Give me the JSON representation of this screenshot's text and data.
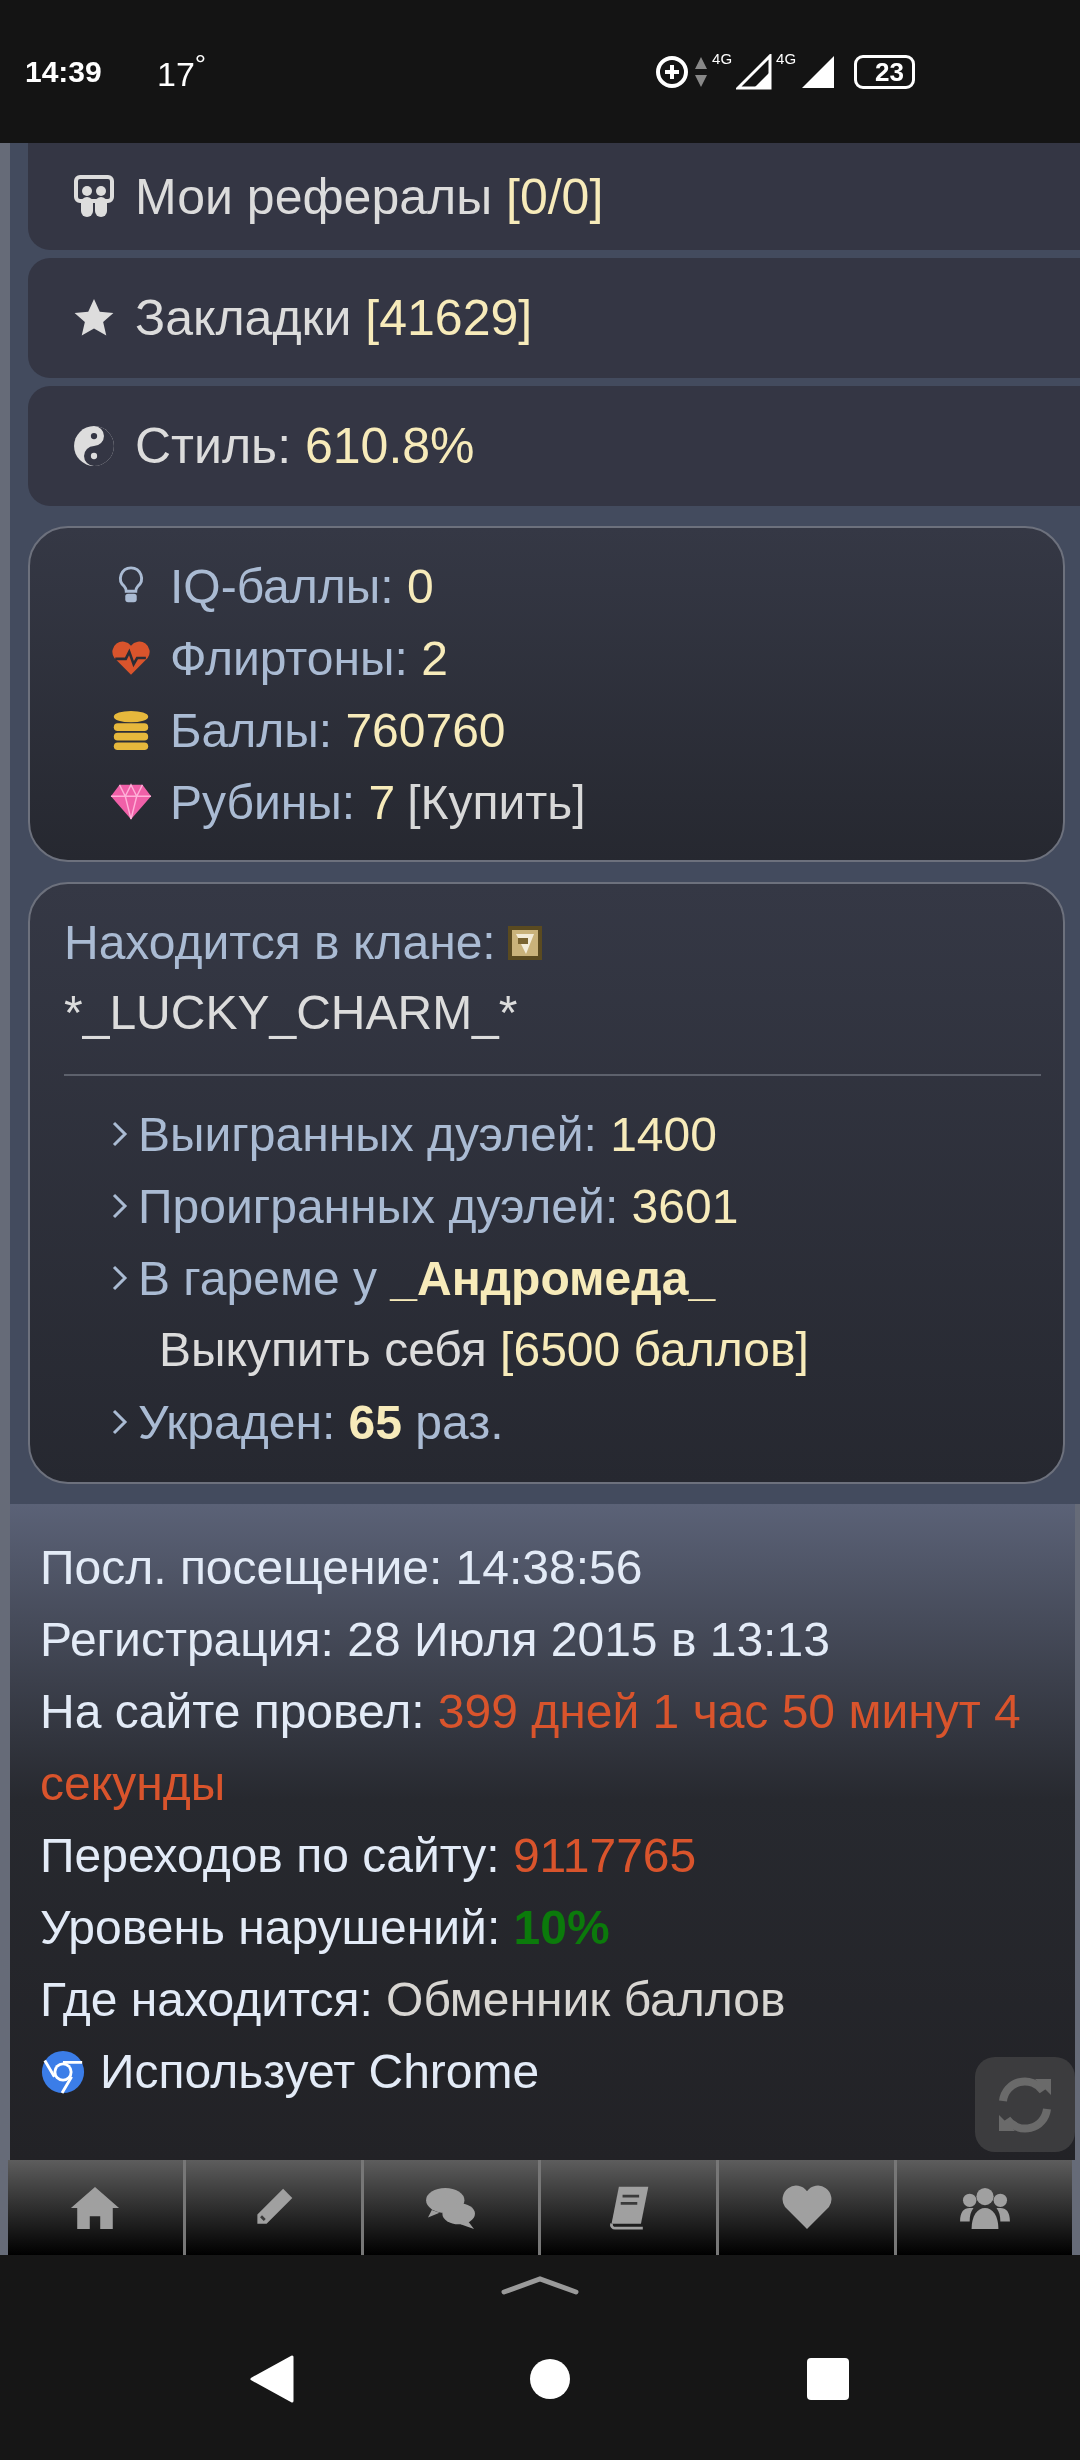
{
  "status_bar": {
    "time": "14:39",
    "temperature": "17$^{°}$",
    "network_1": "4G",
    "network_2": "4G",
    "battery": "23"
  },
  "menu_items": [
    {
      "label": "Мои рефералы",
      "value": "[0/0]"
    },
    {
      "label": "Закладки",
      "value": "[41629]"
    },
    {
      "label": "Стиль:",
      "value": "610.8%"
    }
  ],
  "resources": [
    {
      "label": "IQ-баллы:",
      "value": "0"
    },
    {
      "label": "Флиртоны:",
      "value": "2"
    },
    {
      "label": "Баллы:",
      "value": "760760"
    },
    {
      "label": "Рубины:",
      "value": "7",
      "action": "[Купить]"
    }
  ],
  "clan": {
    "label": "Находится в клане:",
    "name": "*_LUCKY_CHARM_*"
  },
  "duel_stats": [
    {
      "label": "Выигранных дуэлей:",
      "value": "1400",
      "bold": false
    },
    {
      "label": "Проигранных дуэлей:",
      "value": "3601",
      "bold": false
    },
    {
      "label": "В гареме у",
      "value": "_Андромеда_",
      "bold": true,
      "sub_label": "Выкупить себя",
      "sub_value": "[6500 баллов]"
    },
    {
      "label": "Украден:",
      "value": "65",
      "bold": true,
      "suffix": "раз."
    }
  ],
  "info": [
    {
      "label": "Посл. посещение:",
      "value": "14:38:56",
      "color": "#e3ebf7",
      "bold": false
    },
    {
      "label": "Регистрация:",
      "value": "28 Июля 2015 в 13:13",
      "color": "#e3ebf7",
      "bold": false
    },
    {
      "label": "На сайте провел:",
      "value": "399 дней 1 час 50 минут 4 секунды",
      "color": "#d9542c",
      "bold": false
    },
    {
      "label": "Переходов по сайту:",
      "value": "9117765",
      "color": "#d9542c",
      "bold": false
    },
    {
      "label": "Уровень нарушений:",
      "value": "10%",
      "color": "#0b7a0b",
      "bold": true
    },
    {
      "label": "Где находится:",
      "value": "Обменник баллов",
      "color": "#d8d6d2",
      "bold": false
    }
  ],
  "browser": "Использует Chrome"
}
